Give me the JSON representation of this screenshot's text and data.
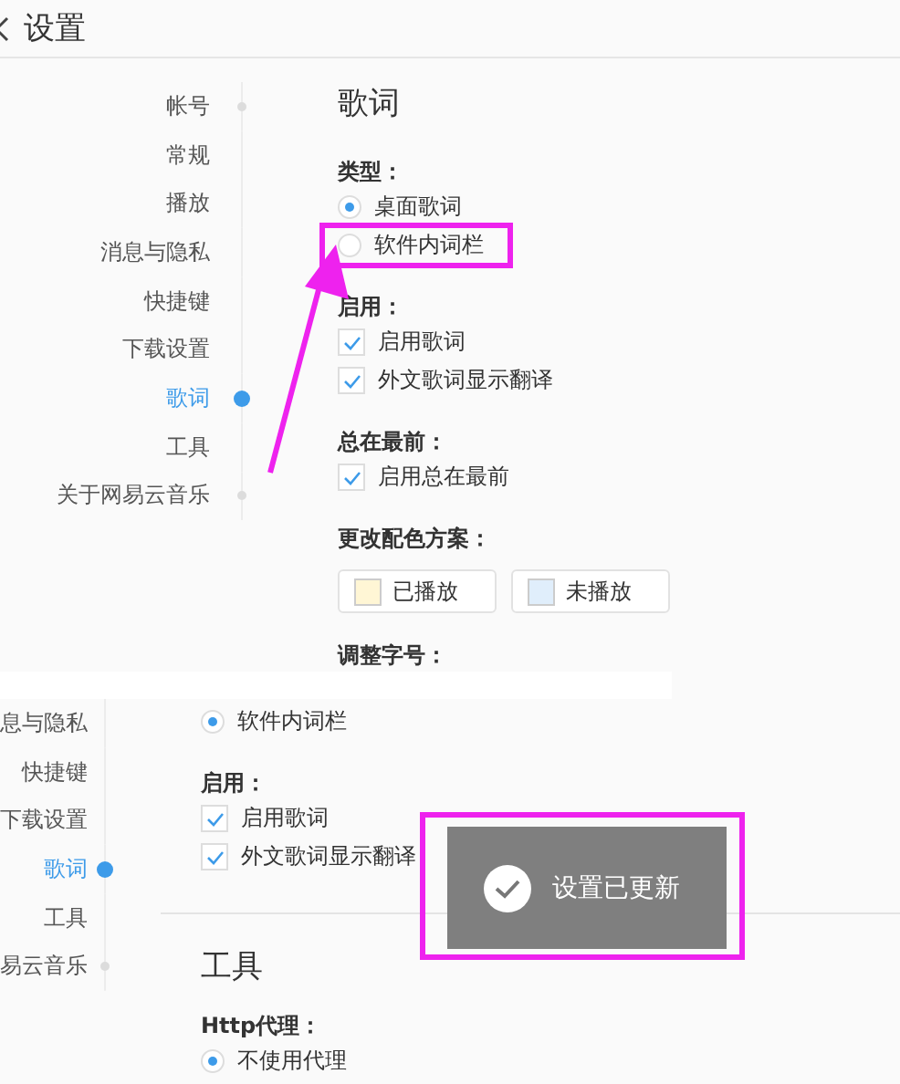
{
  "header": {
    "title": "设置"
  },
  "panels": [
    {
      "sidebar": [
        {
          "label": "帐号",
          "selected": false,
          "end": true
        },
        {
          "label": "常规",
          "selected": false,
          "end": false
        },
        {
          "label": "播放",
          "selected": false,
          "end": false
        },
        {
          "label": "消息与隐私",
          "selected": false,
          "end": false
        },
        {
          "label": "快捷键",
          "selected": false,
          "end": false
        },
        {
          "label": "下载设置",
          "selected": false,
          "end": false
        },
        {
          "label": "歌词",
          "selected": true,
          "end": false
        },
        {
          "label": "工具",
          "selected": false,
          "end": false
        },
        {
          "label": "关于网易云音乐",
          "selected": false,
          "end": true
        }
      ],
      "content": [
        {
          "kind": "heading",
          "text": "歌词"
        },
        {
          "kind": "label",
          "text": "类型："
        },
        {
          "kind": "radio",
          "text": "桌面歌词",
          "selected": true
        },
        {
          "kind": "radio",
          "text": "软件内词栏",
          "selected": false
        },
        {
          "kind": "label",
          "text": "启用："
        },
        {
          "kind": "checkbox",
          "text": "启用歌词",
          "checked": true
        },
        {
          "kind": "checkbox",
          "text": "外文歌词显示翻译",
          "checked": true
        },
        {
          "kind": "label",
          "text": "总在最前："
        },
        {
          "kind": "checkbox",
          "text": "启用总在最前",
          "checked": true
        },
        {
          "kind": "label",
          "text": "更改配色方案："
        },
        {
          "kind": "swatches",
          "items": [
            {
              "text": "已播放",
              "color": "#fff6d5"
            },
            {
              "text": "未播放",
              "color": "#e0eefb"
            }
          ]
        },
        {
          "kind": "label",
          "text": "调整字号："
        }
      ]
    },
    {
      "sidebar": [
        {
          "label": "息与隐私",
          "selected": false,
          "end": false
        },
        {
          "label": "快捷键",
          "selected": false,
          "end": false
        },
        {
          "label": "下载设置",
          "selected": false,
          "end": false
        },
        {
          "label": "歌词",
          "selected": true,
          "end": false
        },
        {
          "label": "工具",
          "selected": false,
          "end": false
        },
        {
          "label": "易云音乐",
          "selected": false,
          "end": true
        }
      ],
      "content": [
        {
          "kind": "radio",
          "text": "软件内词栏",
          "selected": true
        },
        {
          "kind": "label",
          "text": "启用："
        },
        {
          "kind": "checkbox",
          "text": "启用歌词",
          "checked": true
        },
        {
          "kind": "checkbox",
          "text": "外文歌词显示翻译",
          "checked": true
        },
        {
          "kind": "divider"
        },
        {
          "kind": "heading",
          "text": "工具"
        },
        {
          "kind": "label",
          "text": "Http代理："
        },
        {
          "kind": "radio",
          "text": "不使用代理",
          "selected": true
        }
      ],
      "toast": {
        "text": "设置已更新"
      }
    }
  ]
}
